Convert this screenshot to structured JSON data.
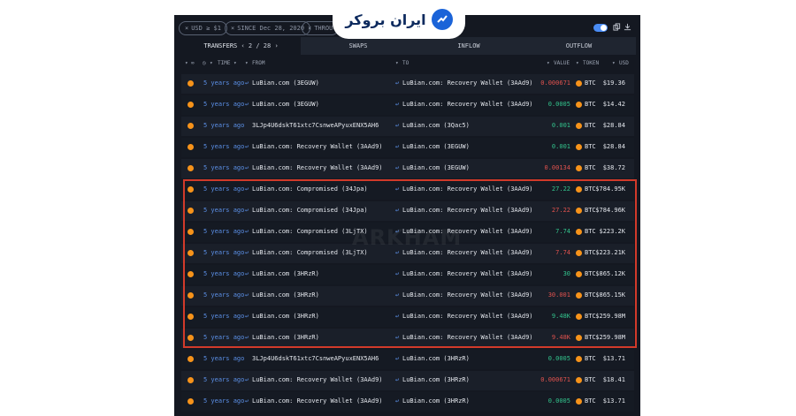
{
  "filters": [
    {
      "label": "USD ≥ $1"
    },
    {
      "label": "SINCE Dec 28, 2020"
    },
    {
      "label": "THROU"
    }
  ],
  "logo": {
    "text": "ایران بروکر"
  },
  "tabs": {
    "transfers": "TRANSFERS",
    "page": "2 / 28",
    "swaps": "SWAPS",
    "inflow": "INFLOW",
    "outflow": "OUTFLOW"
  },
  "columns": {
    "time": "TIME",
    "from": "FROM",
    "to": "TO",
    "value": "VALUE",
    "token": "TOKEN",
    "usd": "USD"
  },
  "watermark": "ARKHAM",
  "colors": {
    "accent": "#5b8fe6",
    "negative": "#e0524e",
    "positive": "#33c48d",
    "highlight": "#d23a2a",
    "btc": "#f7931a"
  },
  "rows": [
    {
      "time": "5 years ago",
      "from": "LuBian.com (3EGUW)",
      "from_arrow": true,
      "to": "LuBian.com: Recovery Wallet (3AAd9)",
      "value": "0.000671",
      "dir": "red",
      "token": "BTC",
      "usd": "$19.36"
    },
    {
      "time": "5 years ago",
      "from": "LuBian.com (3EGUW)",
      "from_arrow": true,
      "to": "LuBian.com: Recovery Wallet (3AAd9)",
      "value": "0.0005",
      "dir": "green",
      "token": "BTC",
      "usd": "$14.42"
    },
    {
      "time": "5 years ago",
      "from": "3LJp4U6dskT61xtc7CsnweAPyuxENX5AH6",
      "from_arrow": false,
      "to": "LuBian.com (3Qac5)",
      "value": "0.001",
      "dir": "green",
      "token": "BTC",
      "usd": "$28.84"
    },
    {
      "time": "5 years ago",
      "from": "LuBian.com: Recovery Wallet (3AAd9)",
      "from_arrow": true,
      "to": "LuBian.com (3EGUW)",
      "value": "0.001",
      "dir": "green",
      "token": "BTC",
      "usd": "$28.84"
    },
    {
      "time": "5 years ago",
      "from": "LuBian.com: Recovery Wallet (3AAd9)",
      "from_arrow": true,
      "to": "LuBian.com (3EGUW)",
      "value": "0.00134",
      "dir": "red",
      "token": "BTC",
      "usd": "$38.72"
    },
    {
      "time": "5 years ago",
      "from": "LuBian.com: Compromised (34Jpa)",
      "from_arrow": true,
      "to": "LuBian.com: Recovery Wallet (3AAd9)",
      "value": "27.22",
      "dir": "green",
      "token": "BTC",
      "usd": "$784.95K"
    },
    {
      "time": "5 years ago",
      "from": "LuBian.com: Compromised (34Jpa)",
      "from_arrow": true,
      "to": "LuBian.com: Recovery Wallet (3AAd9)",
      "value": "27.22",
      "dir": "red",
      "token": "BTC",
      "usd": "$784.96K"
    },
    {
      "time": "5 years ago",
      "from": "LuBian.com: Compromised (3LjTX)",
      "from_arrow": true,
      "to": "LuBian.com: Recovery Wallet (3AAd9)",
      "value": "7.74",
      "dir": "green",
      "token": "BTC",
      "usd": "$223.2K"
    },
    {
      "time": "5 years ago",
      "from": "LuBian.com: Compromised (3LjTX)",
      "from_arrow": true,
      "to": "LuBian.com: Recovery Wallet (3AAd9)",
      "value": "7.74",
      "dir": "red",
      "token": "BTC",
      "usd": "$223.21K"
    },
    {
      "time": "5 years ago",
      "from": "LuBian.com (3HRzR)",
      "from_arrow": true,
      "to": "LuBian.com: Recovery Wallet (3AAd9)",
      "value": "30",
      "dir": "green",
      "token": "BTC",
      "usd": "$865.12K"
    },
    {
      "time": "5 years ago",
      "from": "LuBian.com (3HRzR)",
      "from_arrow": true,
      "to": "LuBian.com: Recovery Wallet (3AAd9)",
      "value": "30.001",
      "dir": "red",
      "token": "BTC",
      "usd": "$865.15K"
    },
    {
      "time": "5 years ago",
      "from": "LuBian.com (3HRzR)",
      "from_arrow": true,
      "to": "LuBian.com: Recovery Wallet (3AAd9)",
      "value": "9.48K",
      "dir": "green",
      "token": "BTC",
      "usd": "$259.98M"
    },
    {
      "time": "5 years ago",
      "from": "LuBian.com (3HRzR)",
      "from_arrow": true,
      "to": "LuBian.com: Recovery Wallet (3AAd9)",
      "value": "9.48K",
      "dir": "red",
      "token": "BTC",
      "usd": "$259.98M"
    },
    {
      "time": "5 years ago",
      "from": "3LJp4U6dskT61xtc7CsnweAPyuxENX5AH6",
      "from_arrow": false,
      "to": "LuBian.com (3HRzR)",
      "value": "0.0005",
      "dir": "green",
      "token": "BTC",
      "usd": "$13.71"
    },
    {
      "time": "5 years ago",
      "from": "LuBian.com: Recovery Wallet (3AAd9)",
      "from_arrow": true,
      "to": "LuBian.com (3HRzR)",
      "value": "0.000671",
      "dir": "red",
      "token": "BTC",
      "usd": "$18.41"
    },
    {
      "time": "5 years ago",
      "from": "LuBian.com: Recovery Wallet (3AAd9)",
      "from_arrow": true,
      "to": "LuBian.com (3HRzR)",
      "value": "0.0005",
      "dir": "green",
      "token": "BTC",
      "usd": "$13.71"
    }
  ]
}
